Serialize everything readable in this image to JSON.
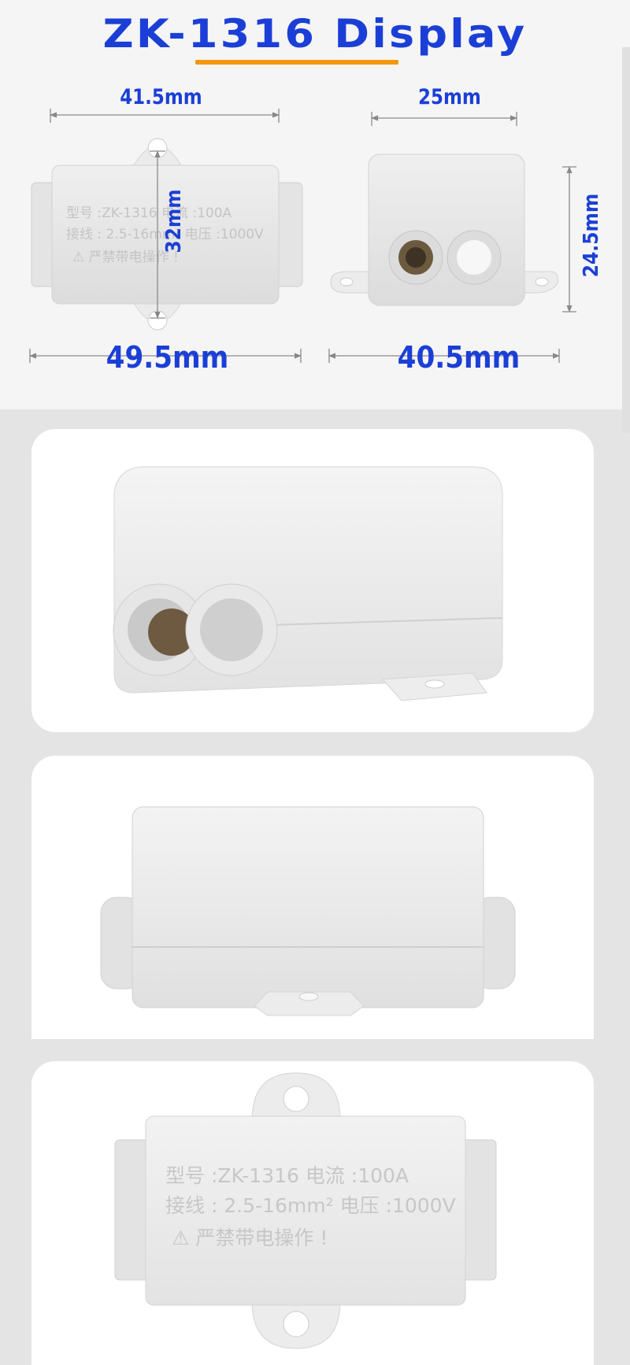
{
  "header": {
    "title": "ZK-1316  Display",
    "accent_color": "#f2980f",
    "title_color": "#1b3fd6"
  },
  "dimensions": {
    "top_width": "41.5mm",
    "side_depth": "25mm",
    "body_height": "32mm",
    "side_height": "24.5mm",
    "total_length": "49.5mm",
    "side_length": "40.5mm"
  },
  "label_small": {
    "line1": "型号 :ZK-1316   电流 :100A",
    "line2": "接线 : 2.5-16mm²  电压 :1000V",
    "line3": "⚠  严禁带电操作 !"
  },
  "label_large": {
    "line1": "型号 :ZK-1316    电流 :100A",
    "line2": "接线 : 2.5-16mm²  电压 :1000V",
    "line3": "⚠  严禁带电操作 !"
  },
  "views": [
    {
      "name": "perspective-view"
    },
    {
      "name": "front-view"
    },
    {
      "name": "top-view"
    }
  ]
}
